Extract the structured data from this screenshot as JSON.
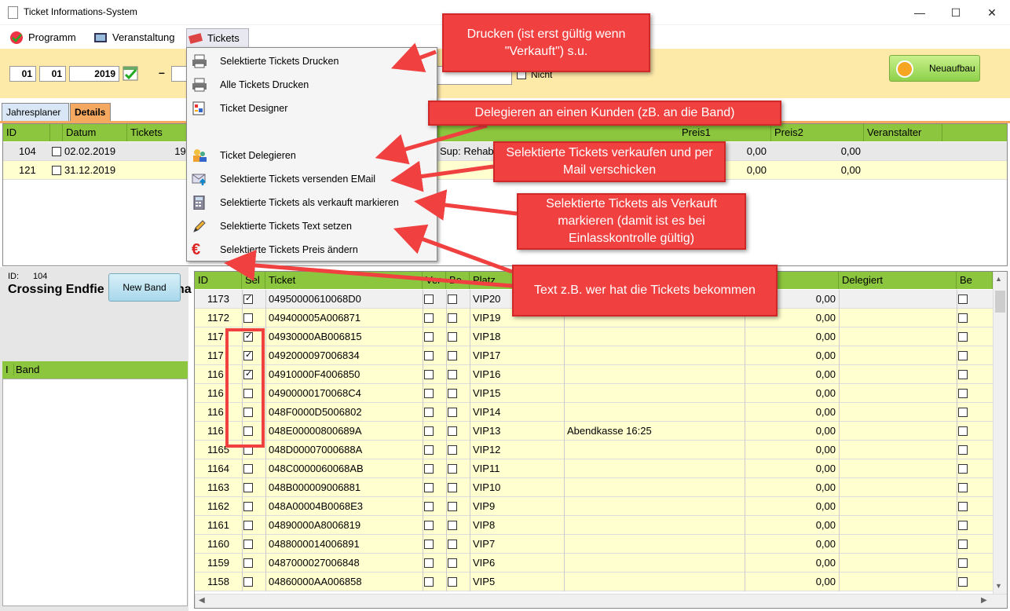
{
  "window": {
    "title": "Ticket Informations-System",
    "minimize": "—",
    "maximize": "☐",
    "close": "✕"
  },
  "menu": {
    "programm": "Programm",
    "veranstaltung": "Veranstaltung",
    "tickets": "Tickets"
  },
  "toolbar": {
    "date_day": "01",
    "date_month": "01",
    "date_year": "2019",
    "dash": "–",
    "nicht_label": "Nicht",
    "neuaufbau": "Neuaufbau"
  },
  "tabs": {
    "jahresplaner": "Jahresplaner",
    "details": "Details"
  },
  "top_grid": {
    "headers": {
      "id": "ID",
      "datum": "Datum",
      "tickets": "Tickets",
      "preis1": "Preis1",
      "preis2": "Preis2",
      "veranstalter": "Veranstalter"
    },
    "rows": [
      {
        "id": "104",
        "datum": "02.02.2019",
        "tickets": "190",
        "name": "Sup: Rehab",
        "preis1": "0,00",
        "preis2": "0,00"
      },
      {
        "id": "121",
        "datum": "31.12.2019",
        "tickets": "0",
        "name": "",
        "preis1": "0,00",
        "preis2": "0,00"
      }
    ]
  },
  "left_panel": {
    "id_label": "ID:",
    "id_value": "104",
    "event_name": "Crossing  Endfie",
    "event_name_tail": "na",
    "new_band": "New Band",
    "band_header_marker": "I",
    "band_header": "Band"
  },
  "ticket_grid": {
    "headers": {
      "id": "ID",
      "sel": "Sel",
      "ticket": "Ticket",
      "ver": "Ver",
      "be": "Be",
      "platz": "Platz",
      "delegiert": "Delegiert",
      "be2": "Be"
    },
    "rows": [
      {
        "id": "1173",
        "ticket": "04950000610068D0",
        "platz": "VIP20",
        "text": "",
        "preis": "0,00",
        "sel": true
      },
      {
        "id": "1172",
        "ticket": "049400005A006871",
        "platz": "VIP19",
        "text": "",
        "preis": "0,00",
        "sel": false
      },
      {
        "id": "117",
        "ticket": "04930000AB006815",
        "platz": "VIP18",
        "text": "",
        "preis": "0,00",
        "sel": true
      },
      {
        "id": "117",
        "ticket": "0492000097006834",
        "platz": "VIP17",
        "text": "",
        "preis": "0,00",
        "sel": true
      },
      {
        "id": "116",
        "ticket": "04910000F4006850",
        "platz": "VIP16",
        "text": "",
        "preis": "0,00",
        "sel": true
      },
      {
        "id": "116",
        "ticket": "04900000170068C4",
        "platz": "VIP15",
        "text": "",
        "preis": "0,00",
        "sel": false
      },
      {
        "id": "116",
        "ticket": "048F0000D5006802",
        "platz": "VIP14",
        "text": "",
        "preis": "0,00",
        "sel": false
      },
      {
        "id": "116",
        "ticket": "048E00000800689A",
        "platz": "VIP13",
        "text": "Abendkasse 16:25",
        "preis": "0,00",
        "sel": false
      },
      {
        "id": "1165",
        "ticket": "048D00007000688A",
        "platz": "VIP12",
        "text": "",
        "preis": "0,00",
        "sel": false
      },
      {
        "id": "1164",
        "ticket": "048C0000060068AB",
        "platz": "VIP11",
        "text": "",
        "preis": "0,00",
        "sel": false
      },
      {
        "id": "1163",
        "ticket": "048B000009006881",
        "platz": "VIP10",
        "text": "",
        "preis": "0,00",
        "sel": false
      },
      {
        "id": "1162",
        "ticket": "048A00004B0068E3",
        "platz": "VIP9",
        "text": "",
        "preis": "0,00",
        "sel": false
      },
      {
        "id": "1161",
        "ticket": "04890000A8006819",
        "platz": "VIP8",
        "text": "",
        "preis": "0,00",
        "sel": false
      },
      {
        "id": "1160",
        "ticket": "0488000014006891",
        "platz": "VIP7",
        "text": "",
        "preis": "0,00",
        "sel": false
      },
      {
        "id": "1159",
        "ticket": "0487000027006848",
        "platz": "VIP6",
        "text": "",
        "preis": "0,00",
        "sel": false
      },
      {
        "id": "1158",
        "ticket": "04860000AA006858",
        "platz": "VIP5",
        "text": "",
        "preis": "0,00",
        "sel": false
      }
    ]
  },
  "dropdown": {
    "items": [
      {
        "label": "Selektierte Tickets Drucken",
        "icon": "printer-icon"
      },
      {
        "label": "Alle Tickets Drucken",
        "icon": "printer-icon"
      },
      {
        "label": "Ticket Designer",
        "icon": "designer-icon"
      },
      {
        "label": "Ticket Delegieren",
        "icon": "people-icon"
      },
      {
        "label": "Selektierte Tickets versenden EMail",
        "icon": "email-icon"
      },
      {
        "label": "Selektierte Tickets als verkauft markieren",
        "icon": "calculator-icon"
      },
      {
        "label": "Selektierte Tickets Text setzen",
        "icon": "pencil-icon"
      },
      {
        "label": "Selektierte Tickets Preis ändern",
        "icon": "euro-icon"
      }
    ]
  },
  "callouts": {
    "drucken": "Drucken (ist erst gültig wenn \"Verkauft\") s.u.",
    "delegieren": "Delegieren an einen Kunden (zB. an die Band)",
    "verkaufen": "Selektierte Tickets verkaufen und per Mail verschicken",
    "markieren": "Selektierte Tickets als Verkauft markieren (damit ist es bei Einlasskontrolle gültig)",
    "text": "Text z.B. wer hat die Tickets bekommen"
  },
  "colors": {
    "header_green": "#8cc63f",
    "row_yellow": "#ffffd0",
    "toolbar_yellow": "#fde9a8",
    "callout_red": "#f04040"
  }
}
